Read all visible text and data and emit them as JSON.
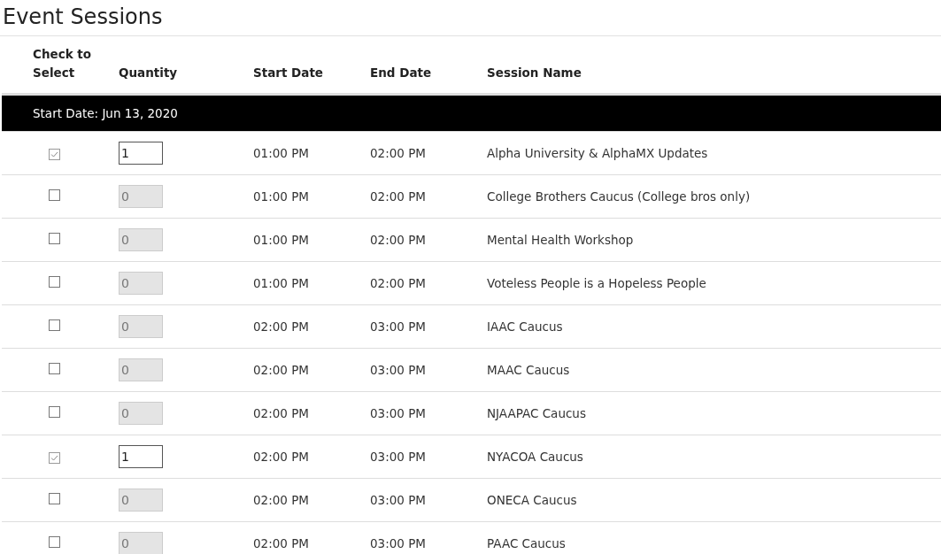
{
  "title": "Event Sessions",
  "columns": [
    "Check to Select",
    "Quantity",
    "Start Date",
    "End Date",
    "Session Name"
  ],
  "group": {
    "label": "Start Date: Jun 13, 2020"
  },
  "rows": [
    {
      "checked": true,
      "disabled": false,
      "quantity": "1",
      "start": "01:00 PM",
      "end": "02:00 PM",
      "name": "Alpha University & AlphaMX Updates"
    },
    {
      "checked": false,
      "disabled": true,
      "quantity": "0",
      "start": "01:00 PM",
      "end": "02:00 PM",
      "name": "College Brothers Caucus (College bros only)"
    },
    {
      "checked": false,
      "disabled": true,
      "quantity": "0",
      "start": "01:00 PM",
      "end": "02:00 PM",
      "name": "Mental Health Workshop"
    },
    {
      "checked": false,
      "disabled": true,
      "quantity": "0",
      "start": "01:00 PM",
      "end": "02:00 PM",
      "name": "Voteless People is a Hopeless People"
    },
    {
      "checked": false,
      "disabled": true,
      "quantity": "0",
      "start": "02:00 PM",
      "end": "03:00 PM",
      "name": "IAAC Caucus"
    },
    {
      "checked": false,
      "disabled": true,
      "quantity": "0",
      "start": "02:00 PM",
      "end": "03:00 PM",
      "name": "MAAC Caucus"
    },
    {
      "checked": false,
      "disabled": true,
      "quantity": "0",
      "start": "02:00 PM",
      "end": "03:00 PM",
      "name": "NJAAPAC Caucus"
    },
    {
      "checked": true,
      "disabled": false,
      "quantity": "1",
      "start": "02:00 PM",
      "end": "03:00 PM",
      "name": "NYACOA Caucus"
    },
    {
      "checked": false,
      "disabled": true,
      "quantity": "0",
      "start": "02:00 PM",
      "end": "03:00 PM",
      "name": "ONECA Caucus"
    },
    {
      "checked": false,
      "disabled": true,
      "quantity": "0",
      "start": "02:00 PM",
      "end": "03:00 PM",
      "name": "PAAC Caucus"
    }
  ]
}
